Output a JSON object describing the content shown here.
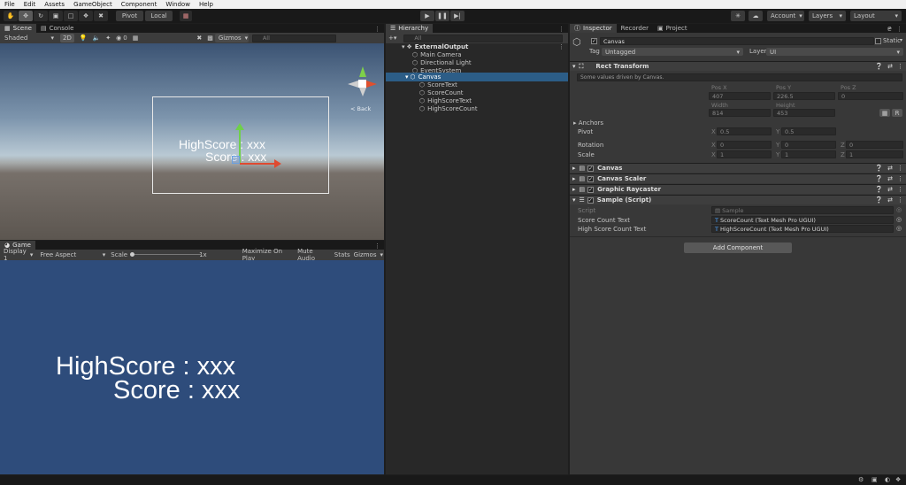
{
  "menu": [
    "File",
    "Edit",
    "Assets",
    "GameObject",
    "Component",
    "Window",
    "Help"
  ],
  "toolbar": {
    "pivot": "Pivot",
    "local": "Local",
    "account": "Account",
    "layers": "Layers",
    "layout": "Layout"
  },
  "scene": {
    "tabs": [
      "Scene",
      "Console"
    ],
    "shading": "Shaded",
    "mode_2d": "2D",
    "fx_count": "0",
    "gizmos": "Gizmos",
    "search_placeholder": "All",
    "back_label": "< Back",
    "text_line1": "HighScore : xxx",
    "text_line2": "Score : xxx"
  },
  "game": {
    "tab": "Game",
    "display": "Display 1",
    "aspect": "Free Aspect",
    "scale_label": "Scale",
    "scale_value": "1x",
    "maximize": "Maximize On Play",
    "mute": "Mute Audio",
    "stats": "Stats",
    "gizmos": "Gizmos",
    "text_line1": "HighScore : xxx",
    "text_line2": "Score : xxx",
    "bg_color": "#2e4c7b"
  },
  "hierarchy": {
    "tab": "Hierarchy",
    "search_placeholder": "All",
    "items": [
      {
        "label": "ExternalOutput",
        "depth": 0
      },
      {
        "label": "Main Camera",
        "depth": 1
      },
      {
        "label": "Directional Light",
        "depth": 1
      },
      {
        "label": "EventSystem",
        "depth": 1
      },
      {
        "label": "Canvas",
        "depth": 1
      },
      {
        "label": "ScoreText",
        "depth": 2
      },
      {
        "label": "ScoreCount",
        "depth": 2
      },
      {
        "label": "HighScoreText",
        "depth": 2
      },
      {
        "label": "HighScoreCount",
        "depth": 2
      }
    ]
  },
  "inspector": {
    "tabs": [
      "Inspector",
      "Recorder",
      "Project"
    ],
    "object_name": "Canvas",
    "static_label": "Static",
    "tag_label": "Tag",
    "tag_value": "Untagged",
    "layer_label": "Layer",
    "layer_value": "UI",
    "rect_transform": {
      "title": "Rect Transform",
      "note": "Some values driven by Canvas.",
      "pos_x_label": "Pos X",
      "pos_y_label": "Pos Y",
      "pos_z_label": "Pos Z",
      "pos_x": "407",
      "pos_y": "226.5",
      "pos_z": "0",
      "width_label": "Width",
      "height_label": "Height",
      "width": "814",
      "height": "453",
      "anchors": "Anchors",
      "pivot": "Pivot",
      "pivot_x": "0.5",
      "pivot_y": "0.5",
      "rotation": "Rotation",
      "rot_x": "0",
      "rot_y": "0",
      "rot_z": "0",
      "scale": "Scale",
      "scale_x": "1",
      "scale_y": "1",
      "scale_z": "1",
      "x": "X",
      "y": "Y",
      "z": "Z",
      "r_btn": "R"
    },
    "components": [
      "Canvas",
      "Canvas Scaler",
      "Graphic Raycaster",
      "Sample (Script)"
    ],
    "script_label": "Script",
    "script_value": "Sample",
    "score_label": "Score Count Text",
    "score_value": "ScoreCount (Text Mesh Pro UGUI)",
    "high_label": "High Score Count Text",
    "high_value": "HighScoreCount (Text Mesh Pro UGUI)",
    "add_component": "Add Component"
  }
}
